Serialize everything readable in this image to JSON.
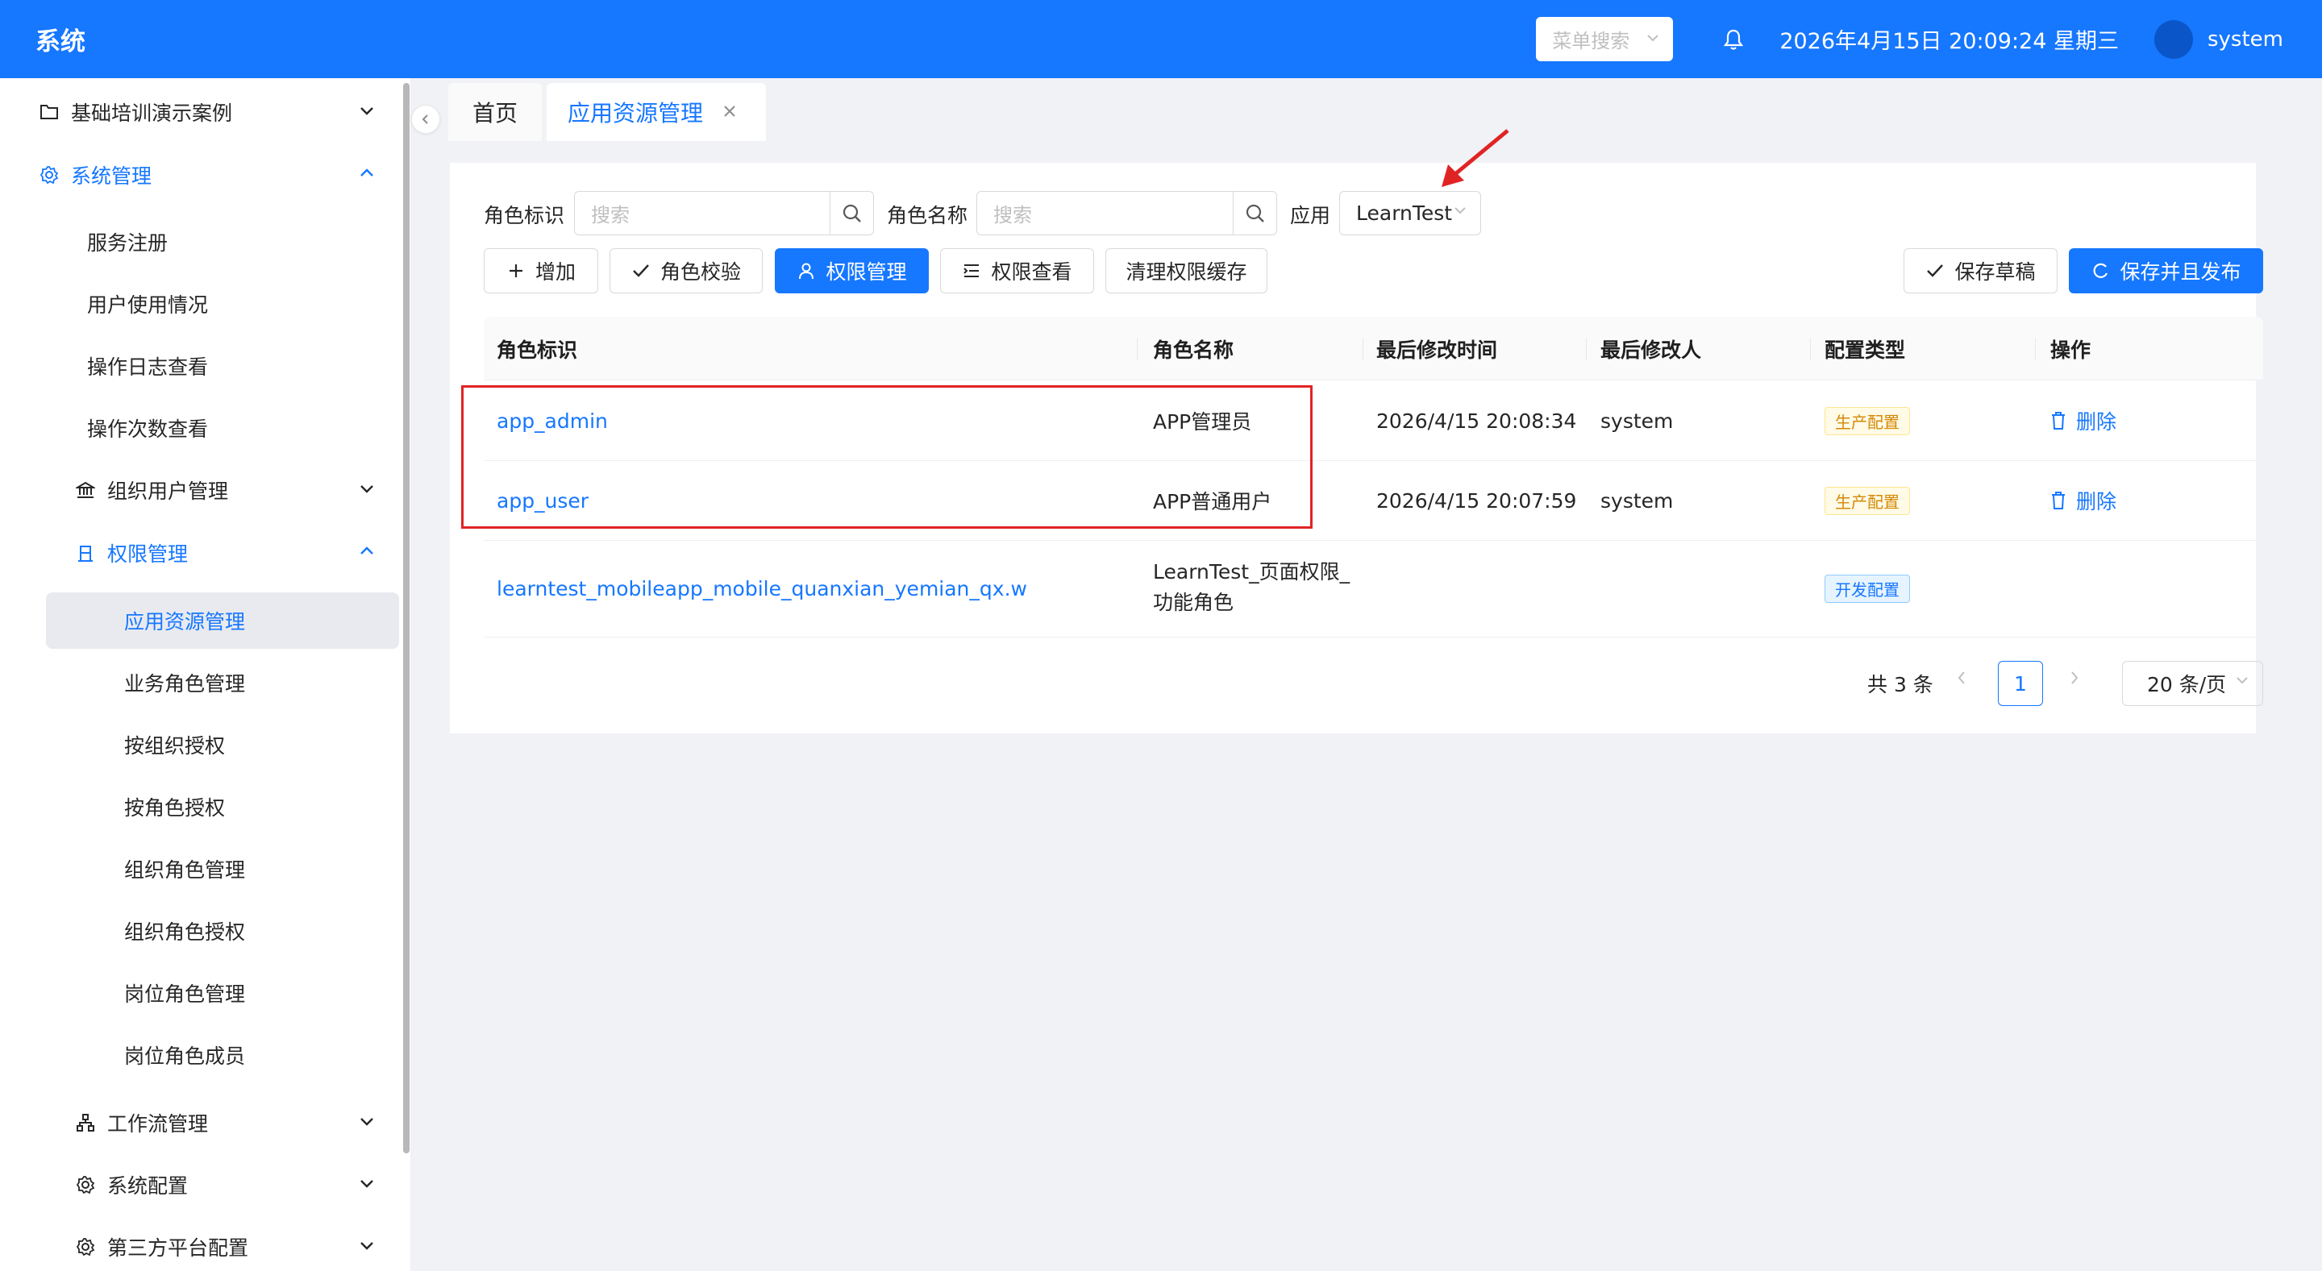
{
  "header": {
    "app_title": "系统",
    "menu_search_placeholder": "菜单搜索",
    "datetime": "2026年4月15日 20:09:24 星期三",
    "username": "system"
  },
  "sidebar": {
    "items": [
      {
        "label": "基础培训演示案例",
        "icon": "folder-icon"
      },
      {
        "label": "系统管理",
        "icon": "gear-icon"
      },
      {
        "label": "服务注册"
      },
      {
        "label": "用户使用情况"
      },
      {
        "label": "操作日志查看"
      },
      {
        "label": "操作次数查看"
      },
      {
        "label": "组织用户管理",
        "icon": "bank-icon"
      },
      {
        "label": "权限管理",
        "icon": "permission-icon"
      },
      {
        "label": "应用资源管理"
      },
      {
        "label": "业务角色管理"
      },
      {
        "label": "按组织授权"
      },
      {
        "label": "按角色授权"
      },
      {
        "label": "组织角色管理"
      },
      {
        "label": "组织角色授权"
      },
      {
        "label": "岗位角色管理"
      },
      {
        "label": "岗位角色成员"
      },
      {
        "label": "工作流管理",
        "icon": "workflow-icon"
      },
      {
        "label": "系统配置",
        "icon": "gear-icon"
      },
      {
        "label": "第三方平台配置",
        "icon": "gear-icon"
      }
    ]
  },
  "tabs": [
    {
      "label": "首页"
    },
    {
      "label": "应用资源管理"
    }
  ],
  "filters": {
    "role_id_label": "角色标识",
    "role_id_placeholder": "搜索",
    "role_name_label": "角色名称",
    "role_name_placeholder": "搜索",
    "app_label": "应用",
    "app_value": "LearnTest"
  },
  "toolbar": {
    "add": "增加",
    "role_check": "角色校验",
    "perm_manage": "权限管理",
    "perm_view": "权限查看",
    "clear_cache": "清理权限缓存",
    "save_draft": "保存草稿",
    "save_publish": "保存并且发布"
  },
  "table": {
    "columns": [
      "角色标识",
      "角色名称",
      "最后修改时间",
      "最后修改人",
      "配置类型",
      "操作"
    ],
    "rows": [
      {
        "role_id": "app_admin",
        "role_name": "APP管理员",
        "modified_time": "2026/4/15 20:08:34",
        "modified_by": "system",
        "config_type": "生产配置",
        "action": "删除"
      },
      {
        "role_id": "app_user",
        "role_name": "APP普通用户",
        "modified_time": "2026/4/15 20:07:59",
        "modified_by": "system",
        "config_type": "生产配置",
        "action": "删除"
      },
      {
        "role_id": "learntest_mobileapp_mobile_quanxian_yemian_qx.w",
        "role_name": "LearnTest_页面权限_功能角色",
        "modified_time": "",
        "modified_by": "",
        "config_type": "开发配置",
        "action": ""
      }
    ]
  },
  "pagination": {
    "total": "共 3 条",
    "current_page": "1",
    "page_size": "20 条/页"
  },
  "colors": {
    "primary": "#1677ff",
    "annotation": "#e02424"
  }
}
